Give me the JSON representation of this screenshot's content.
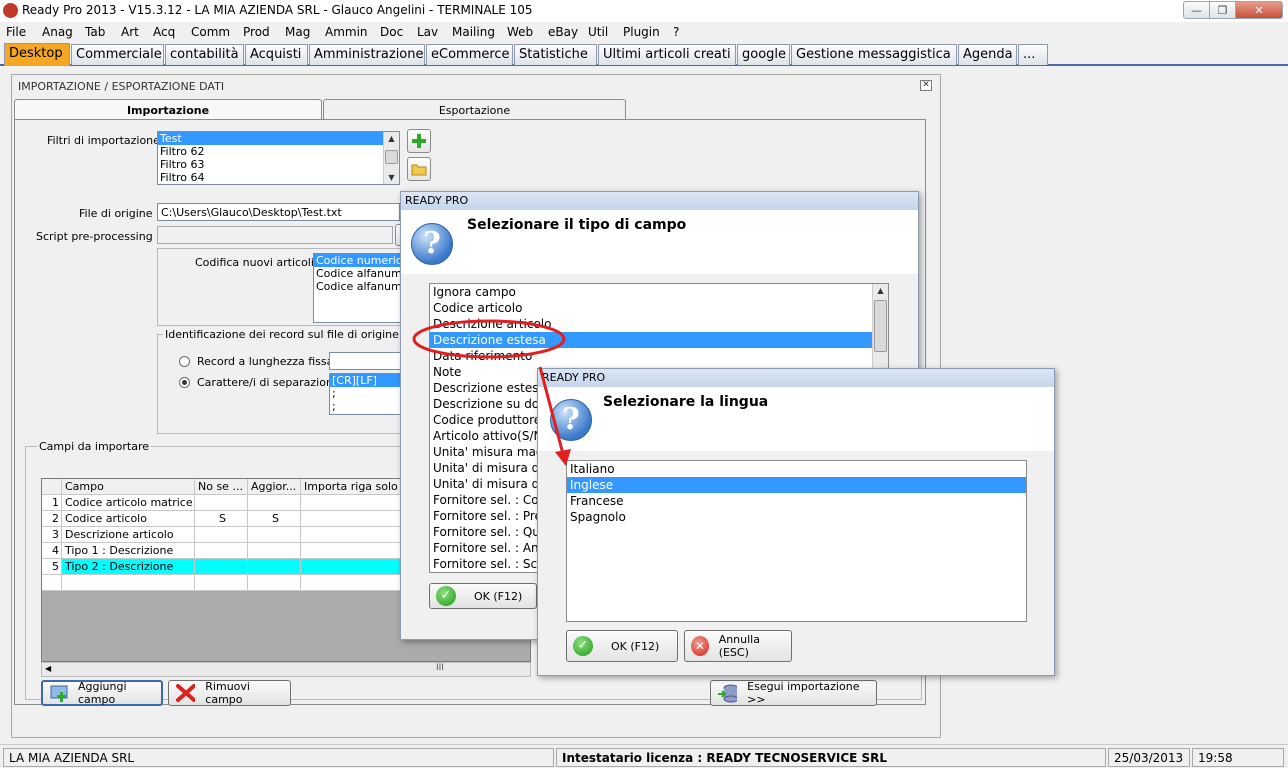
{
  "window": {
    "title": "Ready Pro 2013 - V15.3.12 - LA MIA AZIENDA SRL - Glauco Angelini - TERMINALE 105"
  },
  "menu": [
    "File",
    "Anag",
    "Tab",
    "Art",
    "Acq",
    "Comm",
    "Prod",
    "Mag",
    "Ammin",
    "Doc",
    "Lav",
    "Mailing",
    "Web",
    "eBay",
    "Util",
    "Plugin",
    "?"
  ],
  "tabs": [
    "Desktop",
    "Commerciale",
    "contabilità",
    "Acquisti",
    "Amministrazione",
    "eCommerce",
    "Statistiche",
    "Ultimi articoli creati",
    "google",
    "Gestione messaggistica",
    "Agenda",
    "..."
  ],
  "panel": {
    "title": "IMPORTAZIONE / ESPORTAZIONE DATI",
    "tab_import": "Importazione",
    "tab_export": "Esportazione",
    "filters_label": "Filtri di importazione :",
    "filters": [
      "Test",
      "Filtro 62",
      "Filtro 63",
      "Filtro 64"
    ],
    "source_label": "File di origine :",
    "source_value": "C:\\Users\\Glauco\\Desktop\\Test.txt",
    "script_label": "Script pre-processing :",
    "coding_label": "Codifica nuovi articoli :",
    "coding_options": [
      "Codice numerico p",
      "Codice alfanumeri",
      "Codice alfanumeri"
    ],
    "ident_label": "Identificazione dei record sul file di origine",
    "radio_fixed": "Record a lunghezza fissa",
    "radio_sep": "Carattere/i di separazione",
    "separators": [
      "[CR][LF]",
      ";",
      ";"
    ],
    "fields_label": "Campi da importare",
    "grid_headers": [
      "",
      "Campo",
      "No se ...",
      "Aggior...",
      "Importa riga solo se"
    ],
    "grid_rows": [
      {
        "n": "1",
        "campo": "Codice articolo matrice",
        "a": "",
        "b": ""
      },
      {
        "n": "2",
        "campo": "Codice articolo",
        "a": "S",
        "b": "S"
      },
      {
        "n": "3",
        "campo": "Descrizione articolo",
        "a": "",
        "b": ""
      },
      {
        "n": "4",
        "campo": "Tipo 1 : Descrizione",
        "a": "",
        "b": ""
      },
      {
        "n": "5",
        "campo": "Tipo 2 : Descrizione",
        "a": "",
        "b": ""
      }
    ],
    "hscroll_mark": "III",
    "btn_add": "Aggiungi campo",
    "btn_remove": "Rimuovi campo",
    "btn_run": "Esegui importazione >>"
  },
  "dialog1": {
    "title": "READY PRO",
    "question": "Selezionare il tipo di campo",
    "items": [
      "Ignora campo",
      "Codice articolo",
      "Descrizione articolo",
      "Descrizione estesa",
      "Data riferimento",
      "Note",
      "Descrizione estesa",
      "Descrizione su doc",
      "Codice produttore",
      "Articolo attivo(S/N",
      "Unita' misura mag",
      "Unita' di misura di",
      "Unita' di misura di",
      "Fornitore sel. : Co",
      "Fornitore sel. : Pre",
      "Fornitore sel. : Qu",
      "Fornitore sel. : An",
      "Fornitore sel. : Sc"
    ],
    "selected": 3,
    "ok": "OK (F12)"
  },
  "dialog2": {
    "title": "READY PRO",
    "question": "Selezionare la lingua",
    "items": [
      "Italiano",
      "Inglese",
      "Francese",
      "Spagnolo"
    ],
    "selected": 1,
    "ok": "OK (F12)",
    "cancel": "Annulla (ESC)"
  },
  "status": {
    "company": "LA MIA AZIENDA SRL",
    "license": "Intestatario licenza : READY TECNOSERVICE SRL",
    "date": "25/03/2013",
    "time": "19:58"
  },
  "colors": {
    "tab_active": "#f5a623",
    "selection": "#3399ff",
    "grid_highlight": "#00ffff",
    "annotation": "#e02020"
  }
}
